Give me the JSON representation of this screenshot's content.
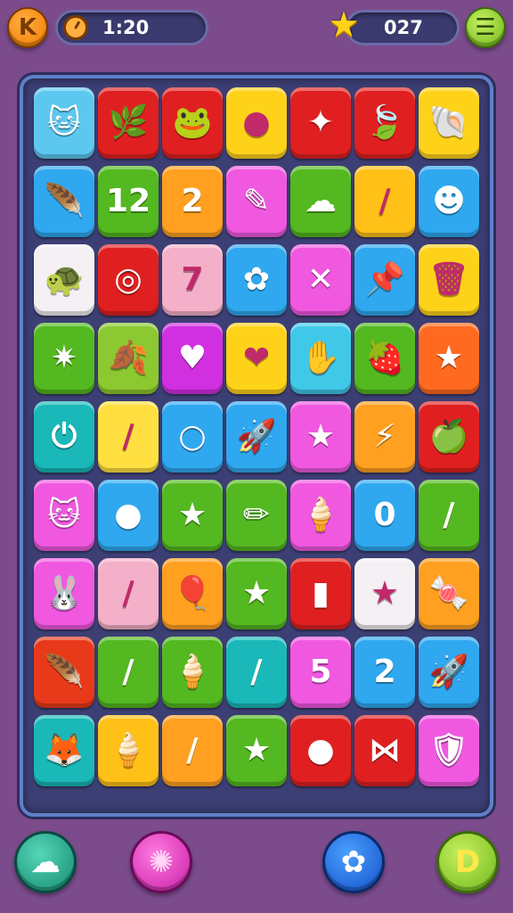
{
  "hud": {
    "back_icon": "back-arrow-icon",
    "back_glyph": "K",
    "timer": "1:20",
    "timer_icon": "stopwatch-icon",
    "score": "027",
    "score_icon": "star-icon",
    "menu_icon": "hamburger-menu-icon",
    "menu_glyph": "☰"
  },
  "board": {
    "rows": [
      [
        {
          "color": "#5cc8f0",
          "icon": "cat-face-icon",
          "glyph": "🐱"
        },
        {
          "color": "#e02020",
          "icon": "leaf-icon",
          "glyph": "🌿"
        },
        {
          "color": "#e02020",
          "icon": "frog-face-icon",
          "glyph": "🐸"
        },
        {
          "color": "#ffd21a",
          "icon": "bean-icon",
          "glyph": "●"
        },
        {
          "color": "#e02020",
          "icon": "star-icon",
          "glyph": "✦"
        },
        {
          "color": "#e02020",
          "icon": "leaf-icon",
          "glyph": "🍃"
        },
        {
          "color": "#ffd21a",
          "icon": "shell-icon",
          "glyph": "🐚"
        }
      ],
      [
        {
          "color": "#2fa8f0",
          "icon": "feather-icon",
          "glyph": "🪶"
        },
        {
          "color": "#54b820",
          "icon": "number-12-icon",
          "glyph": "12"
        },
        {
          "color": "#ffa020",
          "icon": "number-2-icon",
          "glyph": "2"
        },
        {
          "color": "#f058e0",
          "icon": "pencil-icon",
          "glyph": "✎"
        },
        {
          "color": "#54b820",
          "icon": "blob-icon",
          "glyph": "☁"
        },
        {
          "color": "#ffc018",
          "icon": "stick-icon",
          "glyph": "/"
        },
        {
          "color": "#2fa8f0",
          "icon": "round-face-icon",
          "glyph": "☻"
        }
      ],
      [
        {
          "color": "#f4f0f4",
          "icon": "turtle-icon",
          "glyph": "🐢"
        },
        {
          "color": "#e02020",
          "icon": "target-icon",
          "glyph": "◎"
        },
        {
          "color": "#f4b0c8",
          "icon": "number-7-icon",
          "glyph": "7"
        },
        {
          "color": "#2fa8f0",
          "icon": "flower-face-icon",
          "glyph": "✿"
        },
        {
          "color": "#f058e0",
          "icon": "cross-icon",
          "glyph": "✕"
        },
        {
          "color": "#2fa8f0",
          "icon": "pin-icon",
          "glyph": "📌"
        },
        {
          "color": "#ffd21a",
          "icon": "trash-can-icon",
          "glyph": "🗑"
        }
      ],
      [
        {
          "color": "#54b820",
          "icon": "star-burst-icon",
          "glyph": "✷"
        },
        {
          "color": "#8cc830",
          "icon": "leaf-icon",
          "glyph": "🍂"
        },
        {
          "color": "#d030e0",
          "icon": "heart-icon",
          "glyph": "♥"
        },
        {
          "color": "#ffd21a",
          "icon": "heart-icon",
          "glyph": "❤"
        },
        {
          "color": "#40c8e8",
          "icon": "hand-icon",
          "glyph": "✋"
        },
        {
          "color": "#54b820",
          "icon": "berry-icon",
          "glyph": "🍓"
        },
        {
          "color": "#ff6a20",
          "icon": "star-icon",
          "glyph": "★"
        }
      ],
      [
        {
          "color": "#1ab8b8",
          "icon": "power-icon",
          "glyph": "⏻"
        },
        {
          "color": "#ffe040",
          "icon": "stick-icon",
          "glyph": "/"
        },
        {
          "color": "#2fa8f0",
          "icon": "ring-icon",
          "glyph": "○"
        },
        {
          "color": "#2fa8f0",
          "icon": "rocket-icon",
          "glyph": "🚀"
        },
        {
          "color": "#f058e0",
          "icon": "star-icon",
          "glyph": "★"
        },
        {
          "color": "#ffa020",
          "icon": "lightning-star-icon",
          "glyph": "⚡"
        },
        {
          "color": "#e02020",
          "icon": "apple-icon",
          "glyph": "🍏"
        }
      ],
      [
        {
          "color": "#f058e0",
          "icon": "cat-face-icon",
          "glyph": "🐱"
        },
        {
          "color": "#2fa8f0",
          "icon": "bean-icon",
          "glyph": "●"
        },
        {
          "color": "#54b820",
          "icon": "star-icon",
          "glyph": "★"
        },
        {
          "color": "#54b820",
          "icon": "crayon-icon",
          "glyph": "✏"
        },
        {
          "color": "#f058e0",
          "icon": "ice-cream-icon",
          "glyph": "🍦"
        },
        {
          "color": "#2fa8f0",
          "icon": "number-0-icon",
          "glyph": "0"
        },
        {
          "color": "#54b820",
          "icon": "stick-icon",
          "glyph": "/"
        }
      ],
      [
        {
          "color": "#f058e0",
          "icon": "bunny-face-icon",
          "glyph": "🐰"
        },
        {
          "color": "#f4b0c8",
          "icon": "stick-icon",
          "glyph": "/"
        },
        {
          "color": "#ffa020",
          "icon": "balloon-icon",
          "glyph": "🎈"
        },
        {
          "color": "#54b820",
          "icon": "star-icon",
          "glyph": "★"
        },
        {
          "color": "#e02020",
          "icon": "battery-icon",
          "glyph": "▮"
        },
        {
          "color": "#f4f0f4",
          "icon": "star-face-icon",
          "glyph": "★"
        },
        {
          "color": "#ffa020",
          "icon": "candy-icon",
          "glyph": "🍬"
        }
      ],
      [
        {
          "color": "#e83a1a",
          "icon": "feather-icon",
          "glyph": "🪶"
        },
        {
          "color": "#54b820",
          "icon": "stick-icon",
          "glyph": "/"
        },
        {
          "color": "#54b820",
          "icon": "ice-cream-icon",
          "glyph": "🍦"
        },
        {
          "color": "#1ab8b8",
          "icon": "stick-icon",
          "glyph": "/"
        },
        {
          "color": "#f058e0",
          "icon": "number-5-icon",
          "glyph": "5"
        },
        {
          "color": "#2fa8f0",
          "icon": "number-2-icon",
          "glyph": "2"
        },
        {
          "color": "#2fa8f0",
          "icon": "rocket-icon",
          "glyph": "🚀"
        }
      ],
      [
        {
          "color": "#1ab8b8",
          "icon": "fox-face-icon",
          "glyph": "🦊"
        },
        {
          "color": "#ffc018",
          "icon": "ice-cream-icon",
          "glyph": "🍦"
        },
        {
          "color": "#ffa020",
          "icon": "stick-icon",
          "glyph": "/"
        },
        {
          "color": "#54b820",
          "icon": "star-icon",
          "glyph": "★"
        },
        {
          "color": "#e02020",
          "icon": "bean-icon",
          "glyph": "●"
        },
        {
          "color": "#e02020",
          "icon": "bow-icon",
          "glyph": "⋈"
        },
        {
          "color": "#f058e0",
          "icon": "shield-icon",
          "glyph": "🛡"
        }
      ]
    ]
  },
  "bottom": {
    "cloud_icon": "cloud-icon",
    "cloud_glyph": "☁",
    "candy_icon": "candy-icon",
    "candy_glyph": "✺",
    "gear_icon": "gear-icon",
    "gear_glyph": "✿",
    "play_icon": "play-icon",
    "play_glyph": "D"
  }
}
